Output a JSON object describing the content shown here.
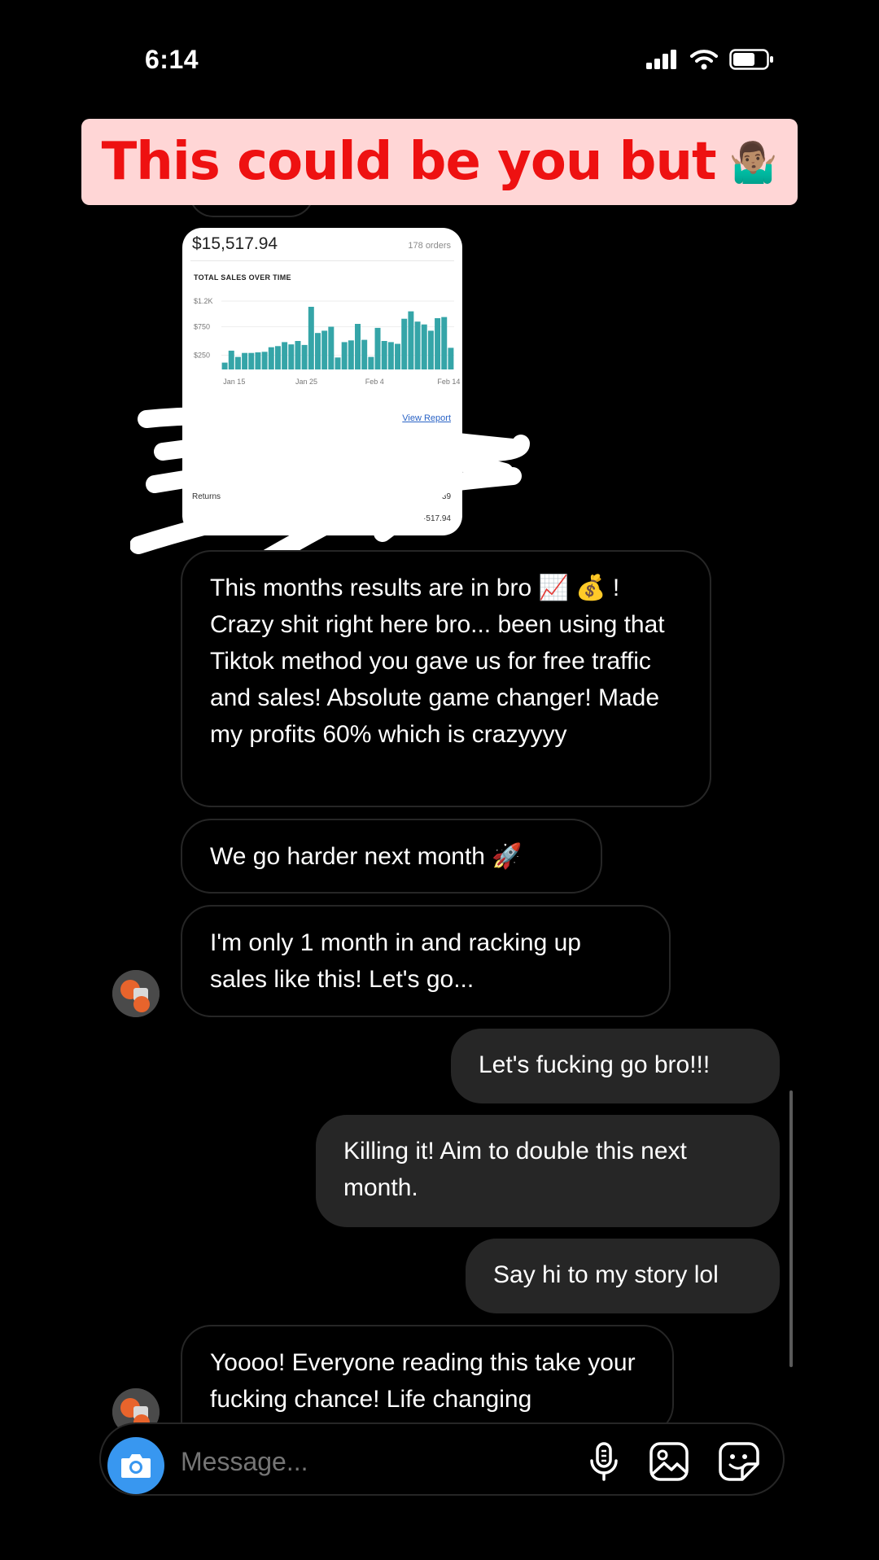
{
  "status_bar": {
    "time": "6:14"
  },
  "banner": {
    "text": "This could be you but",
    "emoji": "🤷🏽‍♂️"
  },
  "shared_screenshot": {
    "total": "$15,517.94",
    "orders": "178 orders",
    "chart_title": "TOTAL SALES OVER TIME",
    "view_report": "View Report",
    "rows": [
      {
        "label": "Returns",
        "value": "-$1· ·39"
      },
      {
        "label": "",
        "value": "·517.94"
      }
    ],
    "chart_data": {
      "type": "bar",
      "title": "TOTAL SALES OVER TIME",
      "y_ticks": [
        "$1.2K",
        "$750",
        "$250"
      ],
      "x_ticks": [
        "Jan 15",
        "Jan 25",
        "Feb 4",
        "Feb 14"
      ],
      "ylim": [
        0,
        1400
      ],
      "bar_color": "#35a5a8",
      "values": [
        120,
        330,
        220,
        290,
        290,
        300,
        310,
        390,
        410,
        480,
        440,
        500,
        430,
        1100,
        640,
        680,
        750,
        210,
        480,
        510,
        800,
        520,
        220,
        730,
        500,
        480,
        450,
        890,
        1020,
        840,
        790,
        680,
        900,
        920,
        380
      ]
    }
  },
  "messages": [
    {
      "side": "in",
      "text": "This months results are in bro 📈 💰 !\nCrazy shit right here bro... been using that Tiktok method you gave us for free traffic and sales! Absolute game changer! Made my profits 60% which is crazyyyy"
    },
    {
      "side": "in",
      "text": "We go harder next month 🚀"
    },
    {
      "side": "in",
      "text": "I'm only 1 month in and racking up sales like this! Let's go..."
    },
    {
      "side": "out",
      "text": "Let's fucking go bro!!!"
    },
    {
      "side": "out",
      "text": "Killing it! Aim to double this next month."
    },
    {
      "side": "out",
      "text": "Say hi to my story lol"
    },
    {
      "side": "in",
      "text": "Yoooo! Everyone reading this take your fucking chance! Life changing"
    }
  ],
  "composer": {
    "placeholder": "Message..."
  },
  "icons": [
    "signal-icon",
    "wifi-icon",
    "battery-icon",
    "camera-icon",
    "microphone-icon",
    "gallery-icon",
    "sticker-icon"
  ],
  "colors": {
    "accent_camera": "#3897f0",
    "banner_bg": "#ffd6d6",
    "banner_text": "#ee1111",
    "outgoing_bubble": "#262626"
  }
}
